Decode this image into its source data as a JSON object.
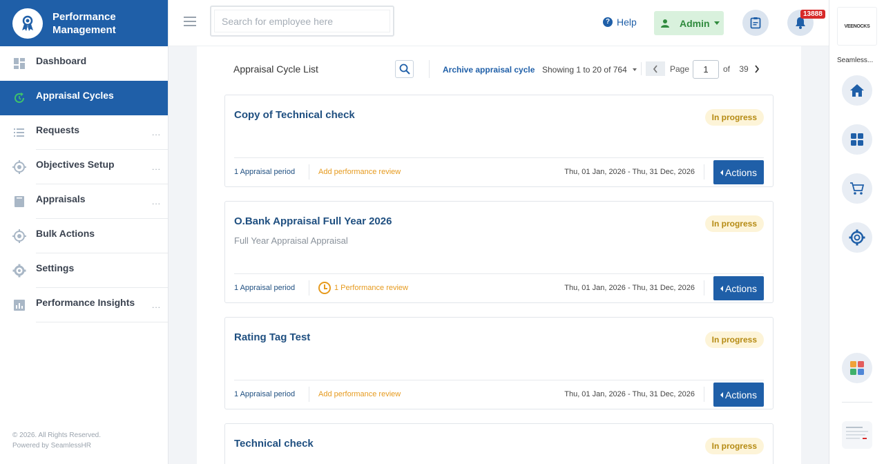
{
  "brand": {
    "title_line1": "Performance",
    "title_line2": "Management"
  },
  "sidebar": {
    "items": [
      {
        "label": "Dashboard",
        "icon": "dashboard-icon",
        "active": false,
        "has_more": false
      },
      {
        "label": "Appraisal Cycles",
        "icon": "cycle-icon",
        "active": true,
        "has_more": false
      },
      {
        "label": "Requests",
        "icon": "checklist-icon",
        "active": false,
        "has_more": true
      },
      {
        "label": "Objectives Setup",
        "icon": "target-icon",
        "active": false,
        "has_more": true
      },
      {
        "label": "Appraisals",
        "icon": "book-icon",
        "active": false,
        "has_more": true
      },
      {
        "label": "Bulk Actions",
        "icon": "target-icon",
        "active": false,
        "has_more": false
      },
      {
        "label": "Settings",
        "icon": "gear-icon",
        "active": false,
        "has_more": false
      },
      {
        "label": "Performance Insights",
        "icon": "chart-icon",
        "active": false,
        "has_more": true
      }
    ],
    "more_glyph": "...",
    "footer_line1": "© 2026. All Rights Reserved.",
    "footer_line2": "Powered by SeamlessHR"
  },
  "topbar": {
    "search_placeholder": "Search for employee here",
    "help_label": "Help",
    "admin_label": "Admin",
    "notification_count": "13888"
  },
  "rail": {
    "logo_text": "VEENOCKS",
    "company_name": "Seamless..."
  },
  "list": {
    "title": "Appraisal Cycle List",
    "archive_label": "Archive appraisal cycle",
    "showing_text": "Showing 1 to 20 of 764",
    "page_label": "Page",
    "page_value": "1",
    "of_label": "of",
    "total_pages": "39"
  },
  "cards": [
    {
      "title": "Copy of Technical check",
      "subtitle": "",
      "status": "In progress",
      "period": "1 Appraisal period",
      "review": "Add performance review",
      "review_has_clock": false,
      "dates": "Thu, 01 Jan, 2026 - Thu, 31 Dec, 2026",
      "action_label": "Actions"
    },
    {
      "title": "O.Bank Appraisal Full Year 2026",
      "subtitle": "Full Year Appraisal Appraisal",
      "status": "In progress",
      "period": "1 Appraisal period",
      "review": "1 Performance review",
      "review_has_clock": true,
      "dates": "Thu, 01 Jan, 2026 - Thu, 31 Dec, 2026",
      "action_label": "Actions"
    },
    {
      "title": "Rating Tag Test",
      "subtitle": "",
      "status": "In progress",
      "period": "1 Appraisal period",
      "review": "Add performance review",
      "review_has_clock": false,
      "dates": "Thu, 01 Jan, 2026 - Thu, 31 Dec, 2026",
      "action_label": "Actions"
    },
    {
      "title": "Technical check",
      "subtitle": "",
      "status": "In progress"
    }
  ],
  "colors": {
    "brand_blue": "#1f5fa8",
    "status_bg": "#fdf4d8",
    "status_text": "#b58a12",
    "review_orange": "#e69a1e",
    "badge_red": "#d72a2a"
  }
}
